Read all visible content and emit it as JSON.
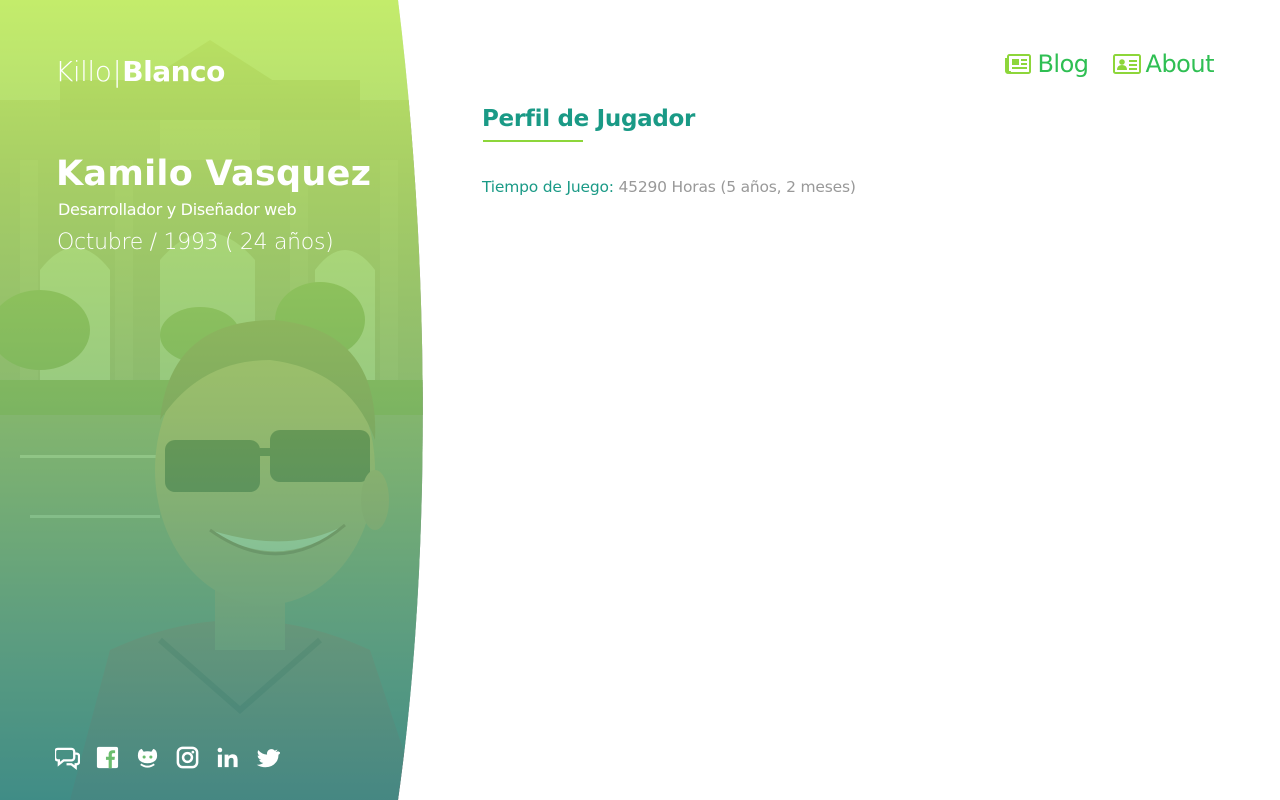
{
  "brand": {
    "logo_light": "Killo",
    "logo_separator": "|",
    "logo_bold": "Blanco"
  },
  "profile": {
    "name": "Kamilo Vasquez",
    "role": "Desarrollador y Diseñador web",
    "birth": "Octubre / 1993 ( 24 años)"
  },
  "nav": {
    "items": [
      {
        "label": "Blog",
        "icon": "newspaper-icon"
      },
      {
        "label": "About",
        "icon": "id-card-icon"
      }
    ]
  },
  "main": {
    "section_title": "Perfil de Jugador",
    "stats": [
      {
        "label": "Tiempo de Juego:",
        "value": "45290 Horas (5 años, 2 meses)"
      }
    ]
  },
  "socials": [
    "comments-icon",
    "facebook-icon",
    "github-icon",
    "instagram-icon",
    "linkedin-icon",
    "twitter-icon"
  ],
  "colors": {
    "accent_green": "#2fbf53",
    "teal": "#1a9a86",
    "underline_lime": "#8dd63a",
    "muted_gray": "#999999"
  }
}
